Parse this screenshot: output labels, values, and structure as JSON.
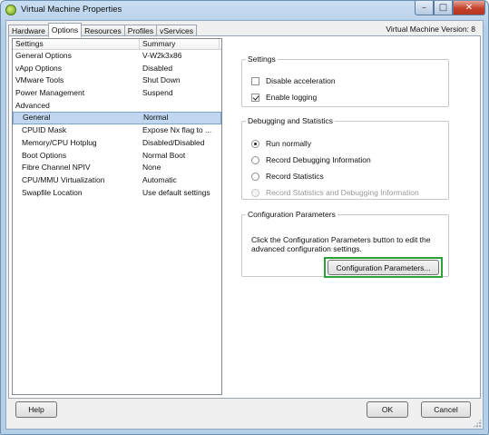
{
  "window": {
    "title": "Virtual Machine Properties",
    "icon": "vsphere-vm-icon",
    "controls": {
      "minimize": "–",
      "maximize": "□",
      "close": "✕"
    }
  },
  "tabs": [
    {
      "label": "Hardware",
      "active": false
    },
    {
      "label": "Options",
      "active": true
    },
    {
      "label": "Resources",
      "active": false
    },
    {
      "label": "Profiles",
      "active": false
    },
    {
      "label": "vServices",
      "active": false
    }
  ],
  "version_label": "Virtual Machine Version: 8",
  "options_list": {
    "headers": {
      "settings": "Settings",
      "summary": "Summary"
    },
    "rows": [
      {
        "setting": "General Options",
        "summary": "V-W2k3x86"
      },
      {
        "setting": "vApp Options",
        "summary": "Disabled"
      },
      {
        "setting": "VMware Tools",
        "summary": "Shut Down"
      },
      {
        "setting": "Power Management",
        "summary": "Suspend"
      },
      {
        "setting": "Advanced",
        "summary": ""
      },
      {
        "setting": "General",
        "summary": "Normal",
        "selected": true
      },
      {
        "setting": "CPUID Mask",
        "summary": "Expose Nx flag to ..."
      },
      {
        "setting": "Memory/CPU Hotplug",
        "summary": "Disabled/Disabled"
      },
      {
        "setting": "Boot Options",
        "summary": "Normal Boot"
      },
      {
        "setting": "Fibre Channel NPIV",
        "summary": "None"
      },
      {
        "setting": "CPU/MMU Virtualization",
        "summary": "Automatic"
      },
      {
        "setting": "Swapfile Location",
        "summary": "Use default settings"
      }
    ]
  },
  "settings_group": {
    "legend": "Settings",
    "disable_acceleration": {
      "label": "Disable acceleration",
      "checked": false
    },
    "enable_logging": {
      "label": "Enable logging",
      "checked": true
    }
  },
  "debug_group": {
    "legend": "Debugging and Statistics",
    "options": [
      {
        "label": "Run normally",
        "checked": true,
        "enabled": true
      },
      {
        "label": "Record Debugging Information",
        "checked": false,
        "enabled": true
      },
      {
        "label": "Record Statistics",
        "checked": false,
        "enabled": true
      },
      {
        "label": "Record Statistics and Debugging Information",
        "checked": false,
        "enabled": false
      }
    ]
  },
  "config_group": {
    "legend": "Configuration Parameters",
    "description": "Click the Configuration Parameters button to edit the advanced configuration settings.",
    "button_label": "Configuration Parameters...",
    "highlight_color": "#2aa23a"
  },
  "footer": {
    "help": "Help",
    "ok": "OK",
    "cancel": "Cancel"
  }
}
